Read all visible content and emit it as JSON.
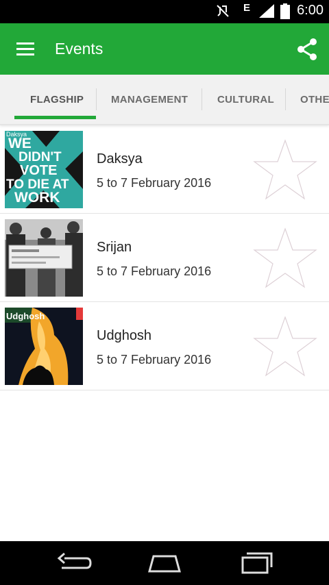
{
  "status_bar": {
    "time": "6:00",
    "network_type": "E",
    "icons": [
      "mute-icon",
      "signal-icon",
      "battery-icon"
    ]
  },
  "app_bar": {
    "title": "Events",
    "menu_icon": "hamburger-menu-icon",
    "share_icon": "share-icon",
    "color": "#22a838"
  },
  "tabs": [
    {
      "label": "FLAGSHIP",
      "selected": true
    },
    {
      "label": "MANAGEMENT",
      "selected": false
    },
    {
      "label": "CULTURAL",
      "selected": false
    },
    {
      "label": "OTHE",
      "selected": false
    }
  ],
  "events": [
    {
      "name": "Daksya",
      "date": "5 to 7 February 2016",
      "thumb": {
        "header": "Daksya",
        "lines": [
          "WE",
          "DIDN'T",
          "VOTE",
          "TO DIE AT",
          "WORK"
        ]
      }
    },
    {
      "name": "Srijan",
      "date": "5 to 7 February 2016"
    },
    {
      "name": "Udghosh",
      "date": "5 to 7 February 2016",
      "thumb": {
        "header": "Udghosh"
      }
    }
  ],
  "nav_bar": {
    "icons": [
      "back-icon",
      "home-icon",
      "recent-apps-icon"
    ]
  }
}
